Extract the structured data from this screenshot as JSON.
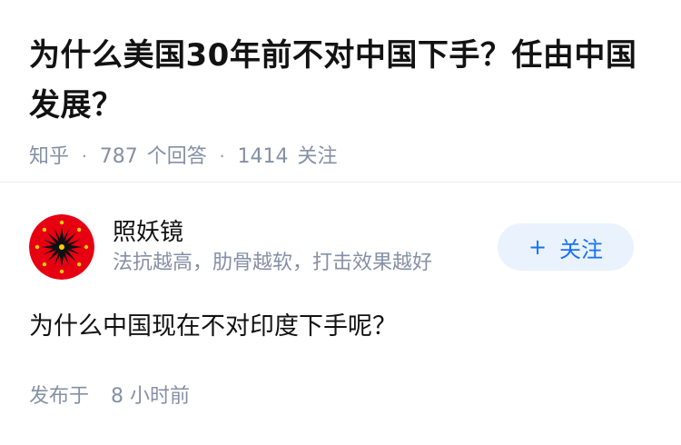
{
  "question": {
    "title": "为什么美国30年前不对中国下手？任由中国发展？",
    "source": "知乎",
    "answer_count": "787",
    "answer_label": "个回答",
    "follower_count": "1414",
    "follower_label": "关注",
    "separator": "·"
  },
  "author": {
    "name": "照妖镜",
    "bio": "法抗越高，肋骨越软，打击效果越好",
    "follow_label": "关注",
    "follow_icon": "plus-icon",
    "avatar_icon": "red-sun-emblem-icon"
  },
  "answer": {
    "text": "为什么中国现在不对印度下手呢？",
    "published_label": "发布于",
    "published_time": "8 小时前"
  },
  "colors": {
    "title": "#121212",
    "meta": "#8590a6",
    "accent": "#1772f6",
    "follow_bg": "#eaf2fd",
    "avatar_red": "#e60012"
  }
}
